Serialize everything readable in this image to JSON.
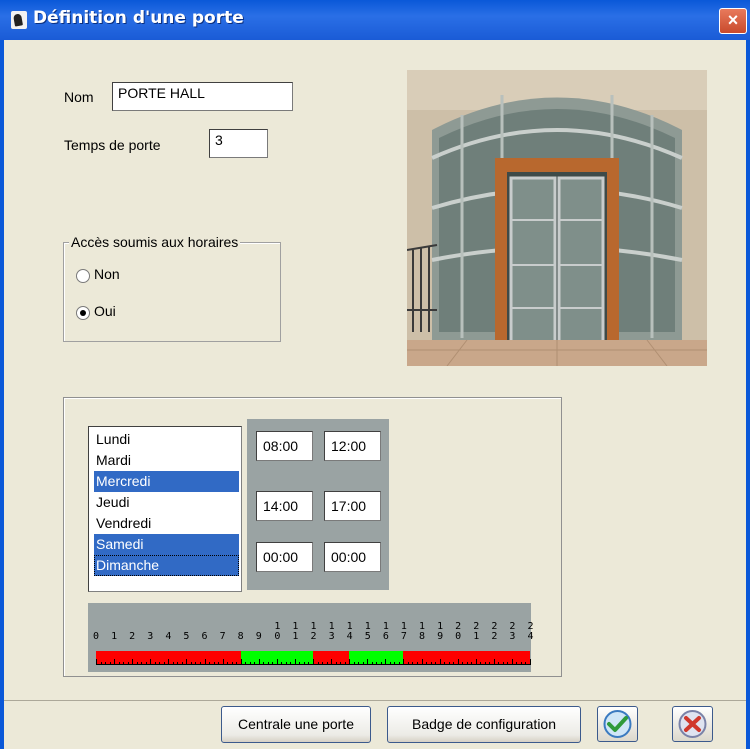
{
  "window": {
    "title": "Définition d'une porte",
    "close_glyph": "×"
  },
  "form": {
    "nom_label": "Nom",
    "nom_value": "PORTE HALL",
    "temps_label": "Temps de porte",
    "temps_value": "3"
  },
  "access_group": {
    "legend": "Accès soumis aux horaires",
    "options": [
      {
        "label": "Non",
        "checked": false
      },
      {
        "label": "Oui",
        "checked": true
      }
    ]
  },
  "days": [
    {
      "label": "Lundi",
      "selected": false
    },
    {
      "label": "Mardi",
      "selected": false
    },
    {
      "label": "Mercredi",
      "selected": true
    },
    {
      "label": "Jeudi",
      "selected": false
    },
    {
      "label": "Vendredi",
      "selected": false
    },
    {
      "label": "Samedi",
      "selected": true
    },
    {
      "label": "Dimanche",
      "selected": true
    }
  ],
  "time_slots": [
    {
      "start": "08:00",
      "end": "12:00"
    },
    {
      "start": "14:00",
      "end": "17:00"
    },
    {
      "start": "00:00",
      "end": "00:00"
    }
  ],
  "timeline": {
    "hour_labels": [
      "0",
      "1",
      "2",
      "3",
      "4",
      "5",
      "6",
      "7",
      "8",
      "9",
      "10",
      "11",
      "12",
      "13",
      "14",
      "15",
      "16",
      "17",
      "18",
      "19",
      "20",
      "21",
      "22",
      "23",
      "24"
    ],
    "segments": [
      {
        "from": 0,
        "to": 8,
        "state": "closed"
      },
      {
        "from": 8,
        "to": 12,
        "state": "open"
      },
      {
        "from": 12,
        "to": 14,
        "state": "closed"
      },
      {
        "from": 14,
        "to": 17,
        "state": "open"
      },
      {
        "from": 17,
        "to": 24,
        "state": "closed"
      }
    ],
    "colors": {
      "open": "#00ff00",
      "closed": "#ff0000"
    }
  },
  "buttons": {
    "centrale": "Centrale une porte",
    "badge": "Badge de configuration",
    "ok_icon": "check-icon",
    "cancel_icon": "cancel-icon"
  }
}
